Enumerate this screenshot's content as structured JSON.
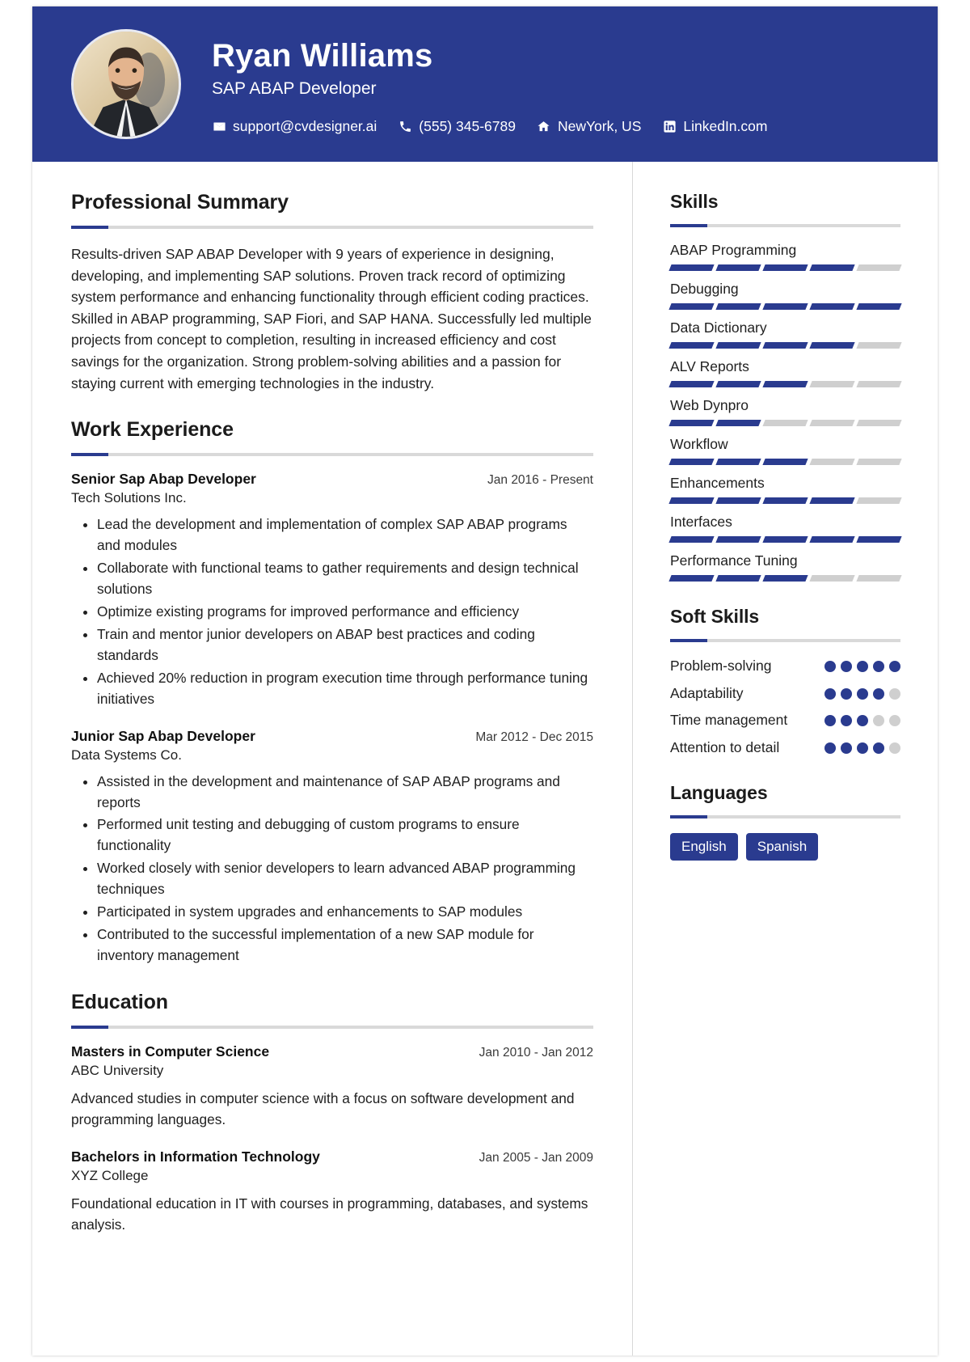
{
  "theme": {
    "accent": "#2a3b8f",
    "track": "#cfcfcf",
    "rule": "#d9d9d9",
    "text": "#1f1f1f"
  },
  "header": {
    "name": "Ryan Williams",
    "role": "SAP ABAP Developer",
    "avatar_alt": "profile-photo",
    "contacts": [
      {
        "icon": "envelope-icon",
        "label": "support@cvdesigner.ai"
      },
      {
        "icon": "phone-icon",
        "label": "(555) 345-6789"
      },
      {
        "icon": "home-icon",
        "label": "NewYork, US"
      },
      {
        "icon": "linkedin-icon",
        "label": "LinkedIn.com"
      }
    ]
  },
  "summary": {
    "title": "Professional Summary",
    "text": "Results-driven SAP ABAP Developer with 9 years of experience in designing, developing, and implementing SAP solutions. Proven track record of optimizing system performance and enhancing functionality through efficient coding practices. Skilled in ABAP programming, SAP Fiori, and SAP HANA. Successfully led multiple projects from concept to completion, resulting in increased efficiency and cost savings for the organization. Strong problem-solving abilities and a passion for staying current with emerging technologies in the industry."
  },
  "experience": {
    "title": "Work Experience",
    "jobs": [
      {
        "title": "Senior Sap Abap Developer",
        "date": "Jan 2016 - Present",
        "org": "Tech Solutions Inc.",
        "bullets": [
          "Lead the development and implementation of complex SAP ABAP programs and modules",
          "Collaborate with functional teams to gather requirements and design technical solutions",
          "Optimize existing programs for improved performance and efficiency",
          "Train and mentor junior developers on ABAP best practices and coding standards",
          "Achieved 20% reduction in program execution time through performance tuning initiatives"
        ]
      },
      {
        "title": "Junior Sap Abap Developer",
        "date": "Mar 2012 - Dec 2015",
        "org": "Data Systems Co.",
        "bullets": [
          "Assisted in the development and maintenance of SAP ABAP programs and reports",
          "Performed unit testing and debugging of custom programs to ensure functionality",
          "Worked closely with senior developers to learn advanced ABAP programming techniques",
          "Participated in system upgrades and enhancements to SAP modules",
          "Contributed to the successful implementation of a new SAP module for inventory management"
        ]
      }
    ]
  },
  "education": {
    "title": "Education",
    "items": [
      {
        "degree": "Masters in Computer Science",
        "date": "Jan 2010 - Jan 2012",
        "school": "ABC University",
        "description": "Advanced studies in computer science with a focus on software development and programming languages."
      },
      {
        "degree": "Bachelors in Information Technology",
        "date": "Jan 2005 - Jan 2009",
        "school": "XYZ College",
        "description": "Foundational education in IT with courses in programming, databases, and systems analysis."
      }
    ]
  },
  "skills": {
    "title": "Skills",
    "max": 5,
    "items": [
      {
        "name": "ABAP Programming",
        "level": 4
      },
      {
        "name": "Debugging",
        "level": 5
      },
      {
        "name": "Data Dictionary",
        "level": 4
      },
      {
        "name": "ALV Reports",
        "level": 3
      },
      {
        "name": "Web Dynpro",
        "level": 2
      },
      {
        "name": "Workflow",
        "level": 3
      },
      {
        "name": "Enhancements",
        "level": 4
      },
      {
        "name": "Interfaces",
        "level": 5
      },
      {
        "name": "Performance Tuning",
        "level": 3
      }
    ]
  },
  "soft_skills": {
    "title": "Soft Skills",
    "max": 5,
    "items": [
      {
        "name": "Problem-solving",
        "level": 5
      },
      {
        "name": "Adaptability",
        "level": 4
      },
      {
        "name": "Time management",
        "level": 3
      },
      {
        "name": "Attention to detail",
        "level": 4
      }
    ]
  },
  "languages": {
    "title": "Languages",
    "items": [
      "English",
      "Spanish"
    ]
  }
}
